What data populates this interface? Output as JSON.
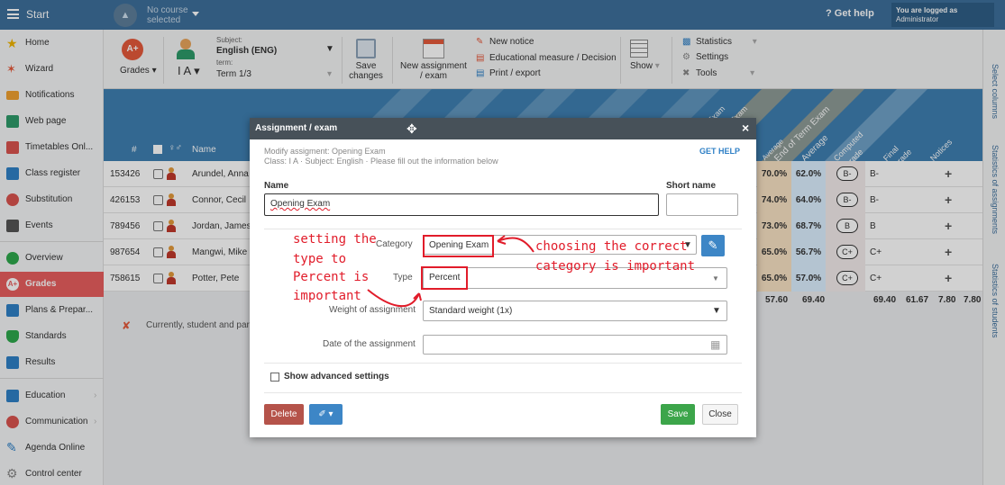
{
  "topbar": {
    "start": "Start",
    "course_line1": "No course",
    "course_line2": "selected",
    "help": "Get help",
    "logged_line1": "You are logged as",
    "logged_line2": "Administrator"
  },
  "sidebar": {
    "items": [
      {
        "label": "Home",
        "icon": "star-icon",
        "color": "#f0b400"
      },
      {
        "label": "Wizard",
        "icon": "wand-icon",
        "color": "#e5593b"
      },
      {
        "label": "Notifications",
        "icon": "envelope-icon",
        "color": "#f0a030"
      },
      {
        "label": "Web page",
        "icon": "house-icon",
        "color": "#2e9a6a"
      },
      {
        "label": "Timetables Onl...",
        "icon": "timetable-icon",
        "color": "#d9534f"
      },
      {
        "label": "Class register",
        "icon": "register-icon",
        "color": "#2f80c6"
      },
      {
        "label": "Substitution",
        "icon": "substitution-icon",
        "color": "#d9534f"
      },
      {
        "label": "Events",
        "icon": "calendar-icon",
        "color": "#555555"
      },
      {
        "label": "Overview",
        "icon": "check-circle-icon",
        "color": "#2ea84c"
      },
      {
        "label": "Grades",
        "icon": "grade-badge-icon",
        "color": "#ffffff"
      },
      {
        "label": "Plans & Prepar...",
        "icon": "plans-icon",
        "color": "#2f80c6"
      },
      {
        "label": "Standards",
        "icon": "shield-icon",
        "color": "#2ea84c"
      },
      {
        "label": "Results",
        "icon": "bar-chart-icon",
        "color": "#2f80c6"
      },
      {
        "label": "Education",
        "icon": "education-icon",
        "color": "#2f80c6"
      },
      {
        "label": "Communication",
        "icon": "chat-icon",
        "color": "#d9534f"
      },
      {
        "label": "Agenda Online",
        "icon": "pen-icon",
        "color": "#2f80c6"
      },
      {
        "label": "Control center",
        "icon": "gear-icon",
        "color": "#888888"
      }
    ]
  },
  "toolbar": {
    "grades": "Grades",
    "class": "I A",
    "subject_label": "Subject:",
    "subject_value": "English (ENG)",
    "term_label": "term:",
    "term_value": "Term 1/3",
    "save_line1": "Save",
    "save_line2": "changes",
    "new_line1": "New assignment",
    "new_line2": "/ exam",
    "new_notice": "New notice",
    "edu_measure": "Educational measure / Decision",
    "print_export": "Print / export",
    "show": "Show",
    "statistics": "Statistics",
    "settings": "Settings",
    "tools": "Tools"
  },
  "grid": {
    "col_num": "#",
    "col_name": "Name",
    "hdr_average": "Average",
    "hdr_end_term": "End of Term Exam",
    "hdr_average2": "Average",
    "hdr_computed_1": "Computed",
    "hdr_computed_2": "grade",
    "hdr_final_1": "Final",
    "hdr_final_2": "grade",
    "hdr_notices": "Notices",
    "hdr_exam1": "Exam",
    "hdr_exam2": "Exam",
    "rows": [
      {
        "id": "153426",
        "name": "Arundel, Anna",
        "p1": "70.0%",
        "p2": "62.0%",
        "grade": "B-",
        "final": "B-"
      },
      {
        "id": "426153",
        "name": "Connor, Cecil",
        "p1": "74.0%",
        "p2": "64.0%",
        "grade": "B-",
        "final": "B-"
      },
      {
        "id": "789456",
        "name": "Jordan, James",
        "p1": "73.0%",
        "p2": "68.7%",
        "grade": "B",
        "final": "B"
      },
      {
        "id": "987654",
        "name": "Mangwi, Mike",
        "p1": "65.0%",
        "p2": "56.7%",
        "grade": "C+",
        "final": "C+"
      },
      {
        "id": "758615",
        "name": "Potter, Pete",
        "p1": "65.0%",
        "p2": "57.0%",
        "grade": "C+",
        "final": "C+"
      }
    ],
    "totals": [
      "57.60",
      "69.40",
      "69.40",
      "61.67",
      "7.80",
      "7.80"
    ],
    "footer_note": "Currently, student and pare"
  },
  "right_strip": {
    "select_columns": "Select columns",
    "stats_assignments": "Statistics of assignments",
    "stats_students": "Statistics of students"
  },
  "dialog": {
    "title": "Assignment / exam",
    "close": "×",
    "info_line1": "Modify assigment: Opening Exam",
    "info_line2": "Class: I A · Subject: English · Please fill out the information below",
    "get_help": "GET HELP",
    "name_label": "Name",
    "name_value": "Opening Exam",
    "short_name_label": "Short name",
    "short_name_value": "",
    "category_label": "Category",
    "category_value": "Opening Exam",
    "type_label": "Type",
    "type_value": "Percent",
    "weight_label": "Weight of assignment",
    "weight_value": "Standard weight (1x)",
    "date_label": "Date of the assignment",
    "date_value": "",
    "advanced_label": "Show advanced settings",
    "delete": "Delete",
    "save": "Save",
    "close_btn": "Close"
  },
  "annotations": {
    "left_1": "setting the",
    "left_2": "type to",
    "left_3": "Percent is",
    "left_4": "important",
    "right_1": "choosing the correct",
    "right_2": "category is important"
  }
}
